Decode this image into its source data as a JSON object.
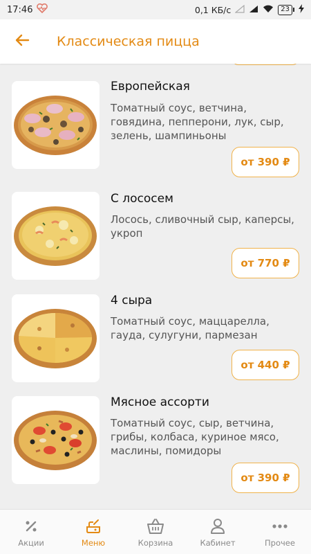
{
  "status_bar": {
    "time": "17:46",
    "network_speed": "0,1 КБ/с",
    "battery_level": "23"
  },
  "header": {
    "title": "Классическая пицца"
  },
  "products": [
    {
      "name": "Европейская",
      "description": "Томатный соус, ветчина, говядина, пепперони, лук, сыр, зелень, шампиньоны",
      "price": "от 390 ₽"
    },
    {
      "name": "С лососем",
      "description": "Лосось, сливочный сыр, каперсы, укроп",
      "price": "от 770 ₽"
    },
    {
      "name": "4 сыра",
      "description": "Томатный соус, маццарелла, гауда, сулугуни, пармезан",
      "price": "от 440 ₽"
    },
    {
      "name": "Мясное ассорти",
      "description": "Томатный соус, сыр, ветчина, грибы, колбаса, куриное мясо, маслины, помидоры",
      "price": "от 390 ₽"
    }
  ],
  "tabs": [
    {
      "label": "Акции",
      "icon": "percent-icon"
    },
    {
      "label": "Меню",
      "icon": "menu-food-icon",
      "active": true
    },
    {
      "label": "Корзина",
      "icon": "basket-icon"
    },
    {
      "label": "Кабинет",
      "icon": "user-icon"
    },
    {
      "label": "Прочее",
      "icon": "more-dots-icon"
    }
  ],
  "colors": {
    "accent": "#e38a14",
    "price_border": "#f0b24a",
    "background": "#efefef"
  }
}
